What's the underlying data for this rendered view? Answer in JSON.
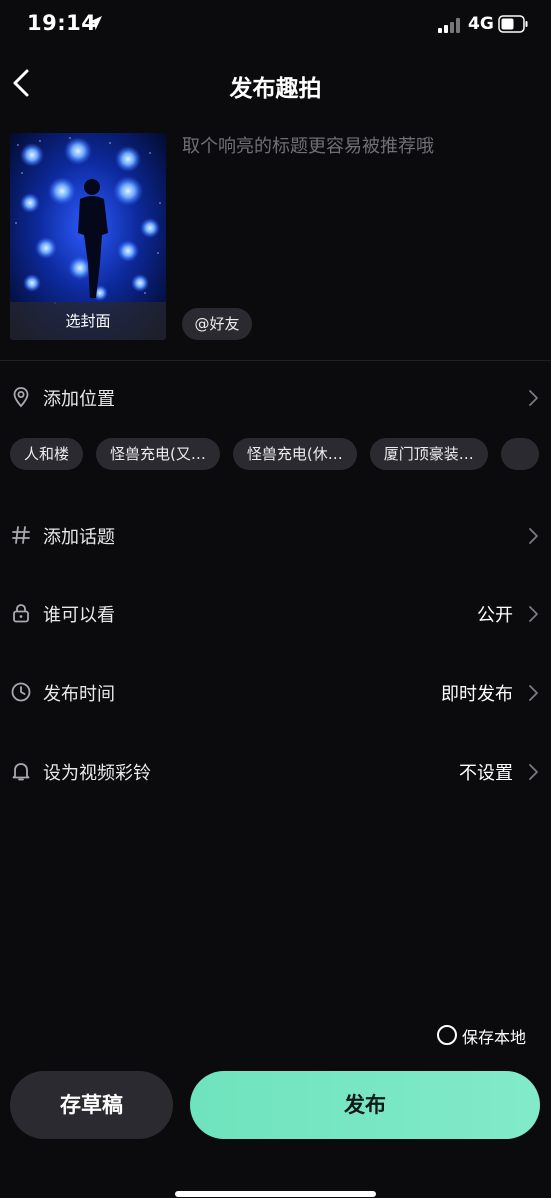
{
  "status_bar": {
    "time": "19:14",
    "network": "4G"
  },
  "nav": {
    "title": "发布趣拍"
  },
  "cover": {
    "select_label": "选封面"
  },
  "title_input": {
    "placeholder": "取个响亮的标题更容易被推荐哦",
    "value": ""
  },
  "mention": {
    "label": "@好友"
  },
  "location": {
    "label": "添加位置",
    "icon": "location-pin-icon",
    "chips": [
      "人和楼",
      "怪兽充电(又…",
      "怪兽充电(休…",
      "厦门顶豪装…"
    ]
  },
  "topic": {
    "label": "添加话题",
    "icon": "hashtag-icon"
  },
  "visibility": {
    "label": "谁可以看",
    "value": "公开",
    "icon": "lock-icon"
  },
  "publish_time": {
    "label": "发布时间",
    "value": "即时发布",
    "icon": "clock-icon"
  },
  "ringtone": {
    "label": "设为视频彩铃",
    "value": "不设置",
    "icon": "bell-icon"
  },
  "save_local": {
    "label": "保存本地",
    "checked": false
  },
  "buttons": {
    "draft": "存草稿",
    "publish": "发布"
  },
  "colors": {
    "background": "#0b0b0d",
    "chip": "#2a2a30",
    "accent": "#7ae6c2",
    "muted_text": "#6f6f76"
  }
}
